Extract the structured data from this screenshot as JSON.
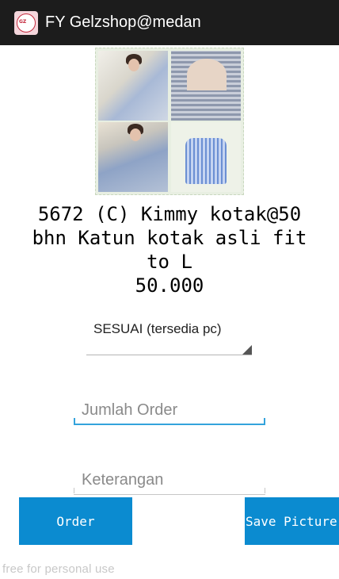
{
  "app": {
    "title": "FY Gelzshop@medan",
    "icon": "shop-logo-icon"
  },
  "product": {
    "description": "5672 (C) Kimmy kotak@50\nbhn Katun kotak asli fit\nto L",
    "price": "50.000"
  },
  "form": {
    "size_spinner": {
      "selected": "SESUAI (tersedia pc)"
    },
    "quantity_field": {
      "placeholder": "Jumlah Order",
      "value": ""
    },
    "note_field": {
      "placeholder": "Keterangan",
      "value": ""
    }
  },
  "buttons": {
    "order_label": "Order",
    "save_picture_label": "Save Picture"
  },
  "watermark": "free for personal use",
  "colors": {
    "action_bar": "#1c1c1c",
    "accent": "#0b8bd0",
    "focus_underline": "#33a3dc"
  }
}
